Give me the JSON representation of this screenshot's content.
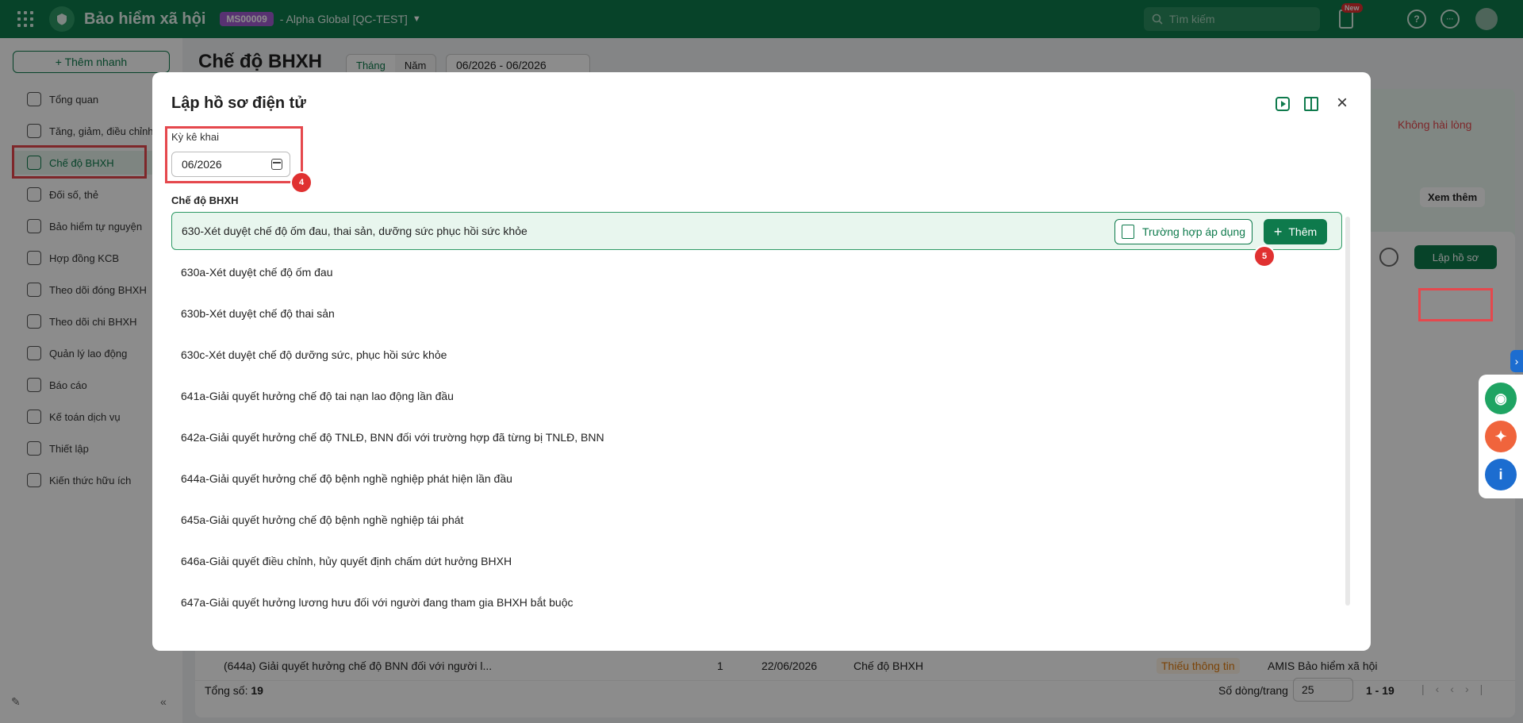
{
  "topbar": {
    "title": "Bảo hiểm xã hội",
    "badge": "MS00009",
    "org": "- Alpha Global [QC-TEST]",
    "search_placeholder": "Tìm kiếm",
    "new_badge": "New",
    "help_icon": "?",
    "more_icon": "···"
  },
  "sidebar": {
    "quick_add": "+ Thêm nhanh",
    "items": [
      {
        "label": "Tổng quan",
        "icon": "home-icon"
      },
      {
        "label": "Tăng, giảm, điều chỉnh",
        "icon": "user-icon"
      },
      {
        "label": "Chế độ BHXH",
        "icon": "shield-icon"
      },
      {
        "label": "Đối số, thẻ",
        "icon": "card-icon"
      },
      {
        "label": "Bảo hiểm tự nguyện",
        "icon": "shield-icon"
      },
      {
        "label": "Hợp đồng KCB",
        "icon": "contract-icon"
      },
      {
        "label": "Theo dõi đóng BHXH",
        "icon": "tracking-icon"
      },
      {
        "label": "Theo dõi chi BHXH",
        "icon": "tracking-icon"
      },
      {
        "label": "Quản lý lao động",
        "icon": "users-icon"
      },
      {
        "label": "Báo cáo",
        "icon": "report-icon"
      },
      {
        "label": "Kế toán dịch vụ",
        "icon": "accounting-icon"
      },
      {
        "label": "Thiết lập",
        "icon": "settings-icon"
      },
      {
        "label": "Kiến thức hữu ích",
        "icon": "knowledge-icon"
      }
    ],
    "collapse_icon": "«"
  },
  "main": {
    "title": "Chế độ BHXH",
    "seg_month": "Tháng",
    "seg_year": "Năm",
    "date_range": "06/2026 - 06/2026",
    "feedback": "Không hài lòng",
    "see_more": "Xem thêm",
    "create_button": "Lập hồ sơ",
    "bottom_row": {
      "name": "(644a) Giải quyết hưởng chế độ BNN đối với người l...",
      "count": "1",
      "date": "22/06/2026",
      "type": "Chế độ BHXH",
      "status": "Thiếu thông tin",
      "source": "AMIS Bảo hiểm xã hội"
    },
    "total_label": "Tổng số:",
    "total_value": "19",
    "rows_per_page_label": "Số dòng/trang",
    "rows_per_page_value": "25",
    "page_range": "1 - 19"
  },
  "modal": {
    "title": "Lập hồ sơ điện tử",
    "period_label": "Kỳ kê khai",
    "period_value": "06/2026",
    "section_label": "Chế độ BHXH",
    "applicable_cases": "Trường hợp áp dụng",
    "add_button": "Thêm",
    "step_4": "4",
    "step_5": "5",
    "items": [
      {
        "code": "630",
        "label": "Xét duyệt chế độ ốm đau, thai sản, dưỡng sức phục hồi sức khỏe"
      },
      {
        "code": "630a",
        "label": "Xét duyệt chế độ ốm đau"
      },
      {
        "code": "630b",
        "label": "Xét duyệt chế độ thai sản"
      },
      {
        "code": "630c",
        "label": "Xét duyệt chế độ dưỡng sức, phục hồi sức khỏe"
      },
      {
        "code": "641a",
        "label": "Giải quyết hưởng chế độ tai nạn lao động lần đầu"
      },
      {
        "code": "642a",
        "label": "Giải quyết hưởng chế độ TNLĐ, BNN đối với trường hợp đã từng bị TNLĐ, BNN"
      },
      {
        "code": "644a",
        "label": "Giải quyết hưởng chế độ bệnh nghề nghiệp phát hiện lần đầu"
      },
      {
        "code": "645a",
        "label": "Giải quyết hưởng chế độ bệnh nghề nghiệp tái phát"
      },
      {
        "code": "646a",
        "label": "Giải quyết điều chỉnh, hủy quyết định chấm dứt hưởng BHXH"
      },
      {
        "code": "647a",
        "label": "Giải quyết hưởng lương hưu đối với người đang tham gia BHXH bắt buộc"
      }
    ]
  },
  "colors": {
    "brand": "#0e7a4c",
    "highlight": "#e5484d",
    "step_badge": "#e03131"
  }
}
